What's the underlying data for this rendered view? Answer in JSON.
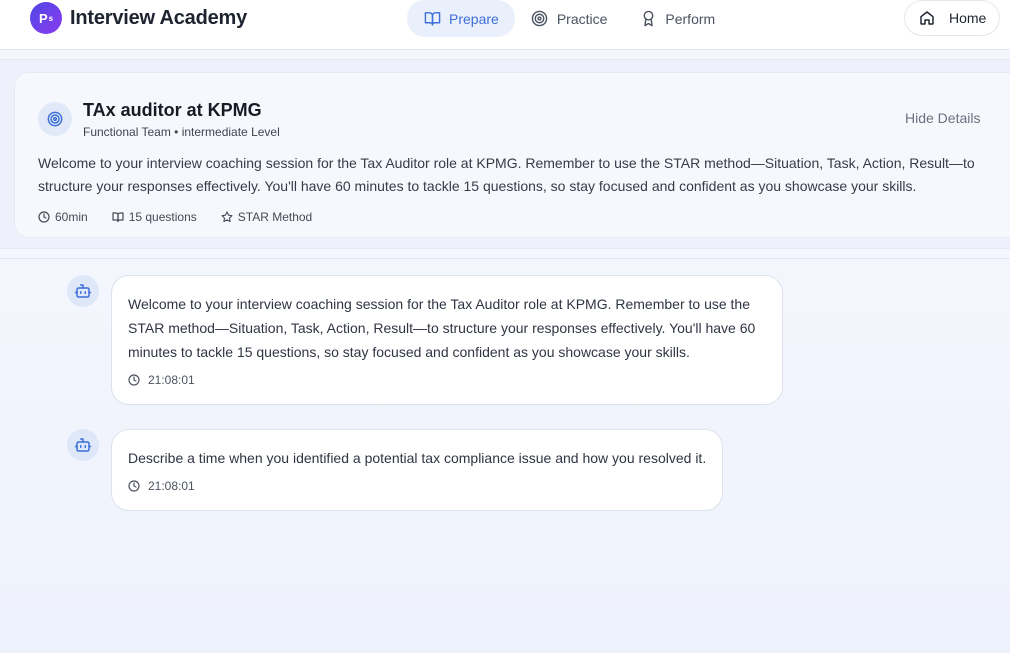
{
  "header": {
    "logo_text": "P",
    "logo_sup": "s",
    "app_name": "Interview Academy",
    "nav": [
      {
        "label": "Prepare",
        "icon": "book-open-icon",
        "active": true
      },
      {
        "label": "Practice",
        "icon": "target-icon",
        "active": false
      },
      {
        "label": "Perform",
        "icon": "award-icon",
        "active": false
      }
    ],
    "home_label": "Home"
  },
  "session": {
    "title": "TAx auditor at KPMG",
    "subtitle": "Functional Team • intermediate Level",
    "hide_details_label": "Hide Details",
    "description": "Welcome to your interview coaching session for the Tax Auditor role at KPMG. Remember to use the STAR method—Situation, Task, Action, Result—to structure your responses effectively. You'll have 60 minutes to tackle 15 questions, so stay focused and confident as you showcase your skills.",
    "meta": {
      "duration": "60min",
      "questions": "15 questions",
      "method": "STAR Method"
    }
  },
  "messages": [
    {
      "text": "Welcome to your interview coaching session for the Tax Auditor role at KPMG. Remember to use the STAR method—Situation, Task, Action, Result—to structure your responses effectively. You'll have 60 minutes to tackle 15 questions, so stay focused and confident as you showcase your skills.",
      "time": "21:08:01"
    },
    {
      "text": "Describe a time when you identified a potential tax compliance issue and how you resolved it.",
      "time": "21:08:01"
    }
  ],
  "colors": {
    "accent": "#3c6fd8",
    "brand_gradient_start": "#4f46e5",
    "brand_gradient_end": "#8b3cf0"
  }
}
